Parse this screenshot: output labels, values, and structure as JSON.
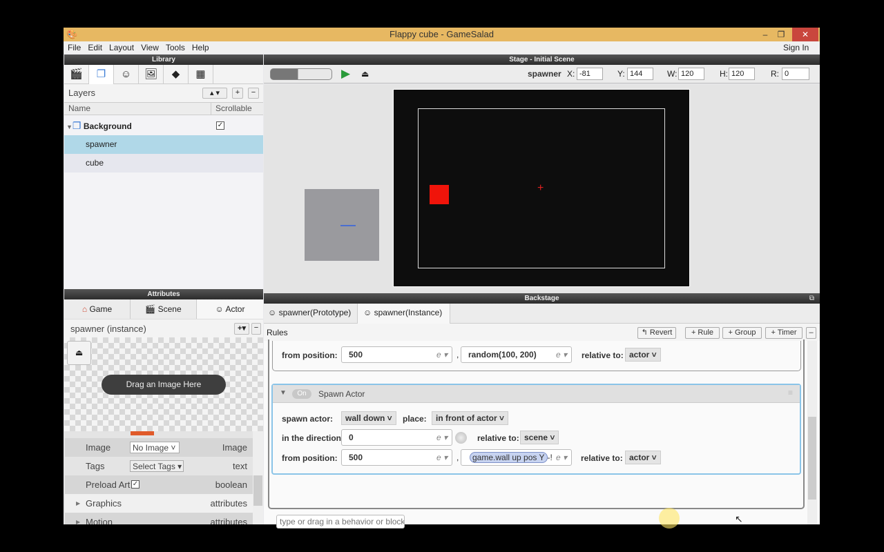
{
  "window": {
    "title": "Flappy cube - GameSalad",
    "minimize": "–",
    "restore": "❐",
    "close": "✕",
    "sign_in": "Sign In"
  },
  "menu": [
    "File",
    "Edit",
    "Layout",
    "View",
    "Tools",
    "Help"
  ],
  "library": {
    "header": "Library",
    "tabs": [
      "scenes-icon",
      "layers-icon",
      "actors-icon",
      "images-icon",
      "behaviors-icon",
      "tables-icon"
    ],
    "layers_title": "Layers",
    "col_name": "Name",
    "col_scrollable": "Scrollable",
    "layers": [
      {
        "name": "Background",
        "scrollable": true
      },
      {
        "name": "spawner",
        "selected": true
      },
      {
        "name": "cube"
      }
    ]
  },
  "attributes": {
    "header": "Attributes",
    "tabs": [
      "Game",
      "Scene",
      "Actor"
    ],
    "active_tab": "Actor",
    "title": "spawner (instance)",
    "drag_hint": "Drag an Image Here",
    "props": [
      {
        "name": "Image",
        "value": "No Image",
        "type": "Image"
      },
      {
        "name": "Tags",
        "value": "Select Tags",
        "type": "text"
      },
      {
        "name": "Preload Art",
        "checked": true,
        "type": "boolean"
      },
      {
        "name": "Graphics",
        "type": "attributes"
      },
      {
        "name": "Motion",
        "type": "attributes"
      }
    ],
    "color_swatch": "#e05a2a"
  },
  "stage": {
    "header": "Stage - Initial Scene",
    "actor": "spawner",
    "x_label": "X:",
    "x": "-81",
    "y_label": "Y:",
    "y": "144",
    "w_label": "W:",
    "w": "120",
    "h_label": "H:",
    "h": "120",
    "r_label": "R:",
    "r": "0"
  },
  "backstage": {
    "header": "Backstage",
    "tabs": [
      "spawner(Prototype)",
      "spawner(Instance)"
    ],
    "rules_label": "Rules",
    "buttons": {
      "revert": "↰ Revert",
      "rule": "+ Rule",
      "group": "+ Group",
      "timer": "+ Timer",
      "minus": "–"
    },
    "prev": {
      "from_label": "from position:",
      "x": "500",
      "y": "random(100, 200)",
      "rel_label": "relative to:",
      "rel": "actor"
    },
    "spawn": {
      "toggle": "On",
      "title": "Spawn Actor",
      "spawn_label": "spawn actor:",
      "actor": "wall down",
      "place_label": "place:",
      "place": "in front of actor",
      "dir_label": "in the direction:",
      "dir": "0",
      "rel_label": "relative to:",
      "dir_rel": "scene",
      "from_label": "from position:",
      "x": "500",
      "y_token": "game.wall up pos Y",
      "y_suffix": "-!",
      "pos_rel": "actor"
    },
    "placeholder": "type or drag in a behavior or block"
  }
}
